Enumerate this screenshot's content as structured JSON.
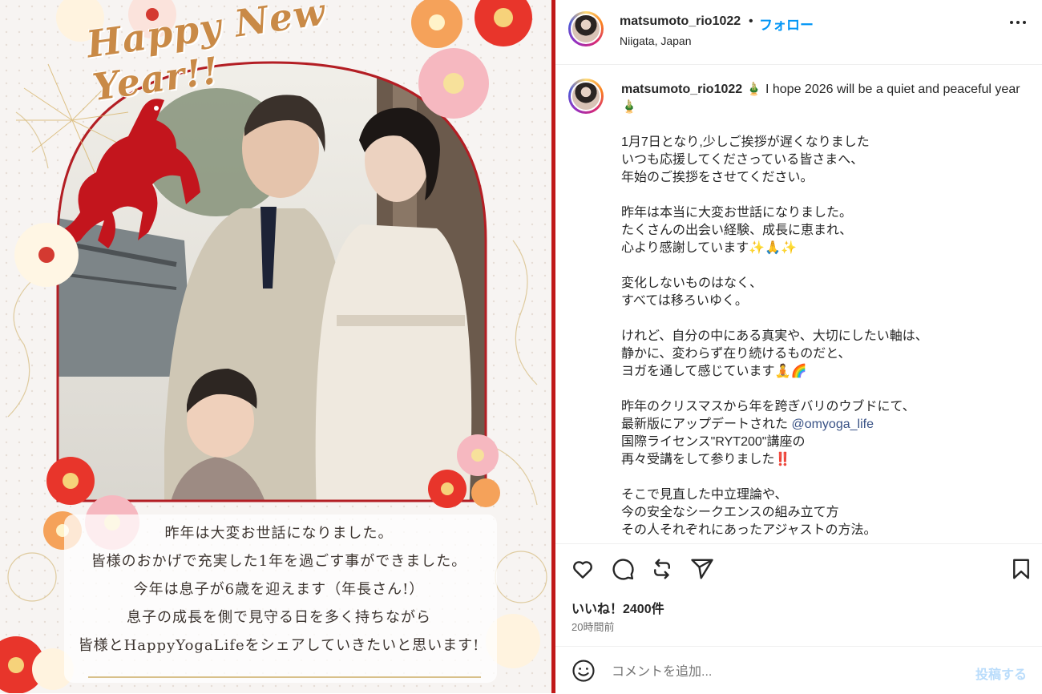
{
  "media": {
    "greeting": "Happy New Year!!",
    "card_lines": [
      "昨年は大変お世話になりました。",
      "皆様のおかげで充実した1年を過ごす事ができました。",
      "今年は息子が6歳を迎えます（年長さん!）",
      "息子の成長を側で見守る日を多く持ちながら",
      "皆様とHappyYogaLifeをシェアしていきたいと思います!"
    ]
  },
  "header": {
    "username": "matsumoto_rio1022",
    "separator": "•",
    "follow_label": "フォロー",
    "location": "Niigata, Japan",
    "more_icon": "more-options-icon"
  },
  "caption": {
    "username": "matsumoto_rio1022",
    "intro": " 🎍 I hope 2026 will be a quiet and peaceful year🎍",
    "paragraphs": [
      [
        "1月7日となり,少しご挨拶が遅くなりました",
        "いつも応援してくださっている皆さまへ、",
        "年始のご挨拶をさせてください。"
      ],
      [
        "昨年は本当に大変お世話になりました。",
        "たくさんの出会い経験、成長に恵まれ、",
        "心より感謝しています✨🙏✨"
      ],
      [
        "変化しないものはなく、",
        "すべては移ろいゆく。"
      ],
      [
        "けれど、自分の中にある真実や、大切にしたい軸は、",
        "静かに、変わらず在り続けるものだと、",
        "ヨガを通して感じています🧘🌈"
      ]
    ],
    "p5_line1": "昨年のクリスマスから年を跨ぎバリのウブドにて、",
    "p5_line2_pre": "最新版にアップデートされた ",
    "p5_mention": "@omyoga_life",
    "p5_line3": "国際ライセンス\"RYT200\"講座の",
    "p5_line4": "再々受講をして参りました‼️",
    "p6": [
      "そこで見直した中立理論や、",
      "今の安全なシークエンスの組み立て方",
      "その人それぞれにあったアジャストの方法。"
    ]
  },
  "actions": {
    "icons": [
      "heart-icon",
      "comment-icon",
      "share-icon",
      "send-icon",
      "bookmark-icon"
    ]
  },
  "likes_label": "いいね！2400件",
  "time_ago": "20時間前",
  "comment": {
    "placeholder": "コメントを追加...",
    "post_label": "投稿する",
    "emoji_icon": "emoji-icon"
  },
  "colors": {
    "accent": "#0095f6",
    "frame_red": "#c01818",
    "mention": "#385185"
  }
}
